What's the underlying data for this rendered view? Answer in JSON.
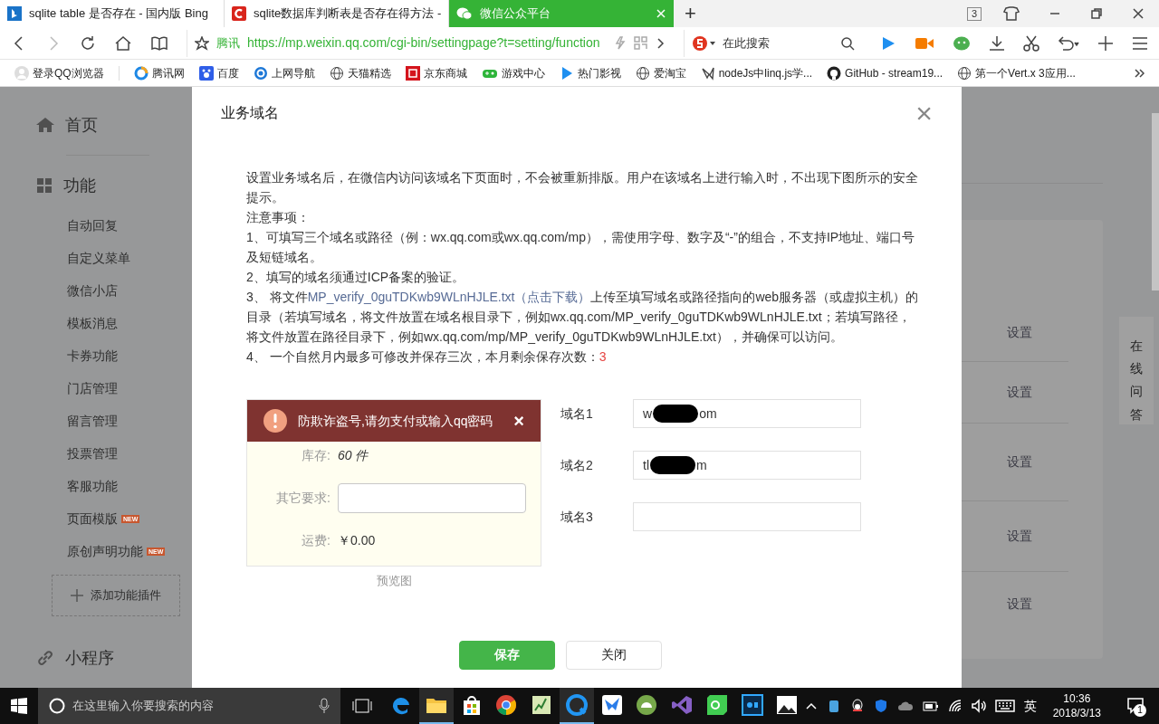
{
  "browser": {
    "tabs": [
      {
        "title": "sqlite table 是否存在 - 国内版 Bing",
        "selected": false
      },
      {
        "title": "sqlite数据库判断表是否存在得方法 -",
        "selected": false
      },
      {
        "title": "微信公众平台",
        "selected": true
      }
    ],
    "new_tab": "+",
    "tab_count": "3",
    "address": {
      "site": "腾讯",
      "url": "https://mp.weixin.qq.com/cgi-bin/settingpage?t=setting/function"
    },
    "search": {
      "placeholder": "在此搜索"
    },
    "bookmarks": [
      {
        "label": "登录QQ浏览器"
      },
      {
        "label": "腾讯网"
      },
      {
        "label": "百度"
      },
      {
        "label": "上网导航"
      },
      {
        "label": "天猫精选"
      },
      {
        "label": "京东商城"
      },
      {
        "label": "游戏中心"
      },
      {
        "label": "热门影视"
      },
      {
        "label": "爱淘宝"
      },
      {
        "label": "nodeJs中linq.js学..."
      },
      {
        "label": "GitHub - stream19..."
      },
      {
        "label": "第一个Vert.x 3应用..."
      }
    ]
  },
  "sidebar": {
    "sections": [
      {
        "label": "首页"
      },
      {
        "label": "功能",
        "items": [
          {
            "label": "自动回复"
          },
          {
            "label": "自定义菜单"
          },
          {
            "label": "微信小店"
          },
          {
            "label": "模板消息"
          },
          {
            "label": "卡券功能"
          },
          {
            "label": "门店管理"
          },
          {
            "label": "留言管理"
          },
          {
            "label": "投票管理"
          },
          {
            "label": "客服功能"
          },
          {
            "label": "页面模版",
            "badge": "NEW"
          },
          {
            "label": "原创声明功能",
            "badge": "NEW"
          }
        ],
        "add_button": "添加功能插件"
      },
      {
        "label": "小程序"
      }
    ]
  },
  "main_content": {
    "rows": [
      {
        "action": "设置"
      },
      {
        "action": "设置"
      },
      {
        "action": "设置"
      },
      {
        "action": "设置"
      },
      {
        "action": "设置"
      }
    ]
  },
  "help_button": "在线问答",
  "dialog": {
    "title": "业务域名",
    "close": "×",
    "paragraphs": [
      "设置业务域名后，在微信内访问该域名下页面时，不会被重新排版。用户在该域名上进行输入时，不出现下图所示的安全提示。",
      "注意事项：",
      "1、可填写三个域名或路径（例：wx.qq.com或wx.qq.com/mp），需使用字母、数字及“-”的组合，不支持IP地址、端口号及短链域名。",
      "2、填写的域名须通过ICP备案的验证。"
    ],
    "step3": {
      "prefix": "3、 将文件",
      "link": "MP_verify_0guTDKwb9WLnHJLE.txt（点击下载）",
      "suffix": "上传至填写域名或路径指向的web服务器（或虚拟主机）的目录（若填写域名，将文件放置在域名根目录下，例如wx.qq.com/MP_verify_0guTDKwb9WLnHJLE.txt；若填写路径，将文件放置在路径目录下，例如wx.qq.com/mp/MP_verify_0guTDKwb9WLnHJLE.txt），并确保可以访问。"
    },
    "step4": {
      "text": "4、 一个自然月内最多可修改并保存三次，本月剩余保存次数：",
      "count": "3"
    },
    "preview": {
      "warning": "防欺诈盗号,请勿支付或输入qq密码",
      "warning_close": "×",
      "rows": [
        {
          "kind": "text",
          "label": "库存:",
          "value": "60 件"
        },
        {
          "kind": "input",
          "label": "其它要求:"
        },
        {
          "kind": "text",
          "label": "运费:",
          "value": "￥0.00"
        }
      ],
      "caption": "预览图"
    },
    "domains": [
      {
        "label": "域名1",
        "visible_start": "w",
        "visible_end": "om",
        "redacted": true
      },
      {
        "label": "域名2",
        "visible_start": "tl",
        "visible_end": "m",
        "redacted": true
      },
      {
        "label": "域名3",
        "redacted": false
      }
    ],
    "buttons": [
      {
        "label": "保存",
        "kind": "primary"
      },
      {
        "label": "关闭",
        "kind": "default"
      }
    ]
  },
  "taskbar": {
    "search_placeholder": "在这里输入你要搜索的内容",
    "apps": [
      {
        "active": false
      },
      {
        "active": true
      },
      {
        "active": false
      },
      {
        "active": false
      },
      {
        "active": false
      },
      {
        "active": true
      },
      {
        "active": false
      },
      {
        "active": false
      },
      {
        "active": false
      },
      {
        "active": false
      },
      {
        "active": false
      },
      {
        "active": false
      }
    ],
    "ime": "英",
    "time": "10:36",
    "date": "2018/3/13",
    "notifications": "1"
  }
}
